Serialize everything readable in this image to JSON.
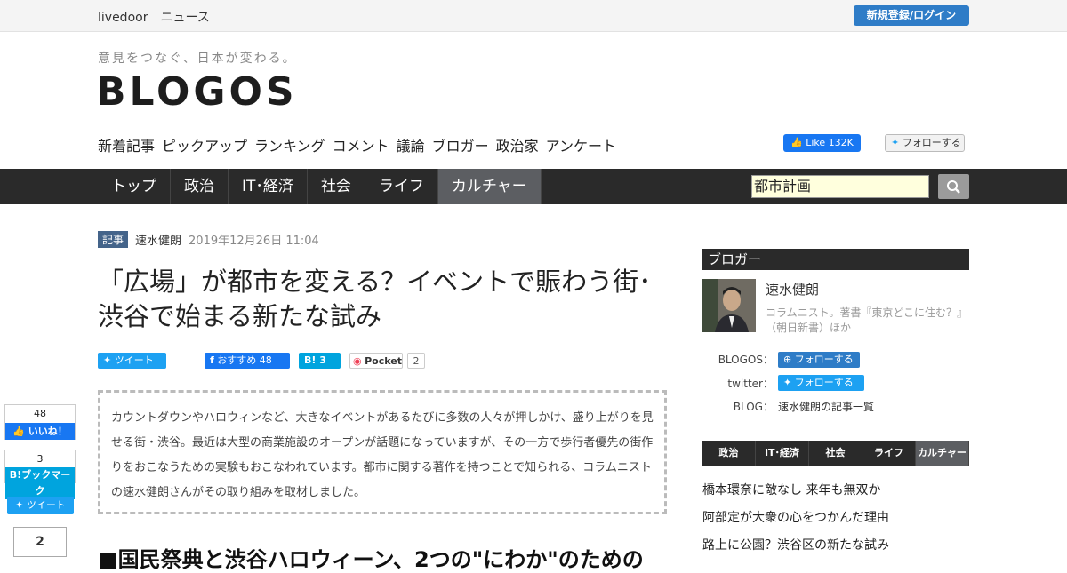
{
  "topbar": {
    "site": "livedoor　ニュース",
    "login": "新規登録/ログイン"
  },
  "brand": {
    "tagline": "意見をつなぐ、日本が変わる。",
    "logo": "BLOGOS"
  },
  "subnav": [
    "新着記事",
    "ピックアップ",
    "ランキング",
    "コメント",
    "議論",
    "ブロガー",
    "政治家",
    "アンケート"
  ],
  "social": {
    "fb_like": "Like 132K",
    "tw_follow": "フォローする"
  },
  "mainnav": [
    "トップ",
    "政治",
    "IT･経済",
    "社会",
    "ライフ",
    "カルチャー"
  ],
  "search": {
    "value": "都市計画"
  },
  "article": {
    "badge": "記事",
    "author": "速水健朗",
    "date": "2019年12月26日 11:04",
    "title": "「広場」が都市を変える？イベントで賑わう街･ 渋谷で始まる新たな試み",
    "lead": "カウントダウンやハロウィンなど、大きなイベントがあるたびに多数の人々が押しかけ、盛り上がりを見せる街・渋谷。最近は大型の商業施設のオープンが話題になっていますが、その一方で歩行者優先の街作りをおこなうための実験もおこなわれています。都市に関する著作を持つことで知られる、コラムニストの速水健朗さんがその取り組みを取材しました。",
    "heading": "■国民祭典と渋谷ハロウィーン、2つの\"にわか\"のための"
  },
  "share": {
    "tweet": "ツイート",
    "fb": "おすすめ 48",
    "hatena": "B! 3",
    "pocket": "Pocket",
    "pocket_count": "2"
  },
  "side": {
    "like_count": "48",
    "like_label": "いいね！",
    "bm_count": "3",
    "bm_label": "B!ブックマーク",
    "tweet": "ツイート",
    "pocket_count": "2"
  },
  "right": {
    "head": "ブロガー",
    "name": "速水健朗",
    "desc": "コラムニスト。著書『東京どこに住む？』（朝日新書）ほか",
    "blogos_label": "BLOGOS：",
    "blogos_btn": "フォローする",
    "twitter_label": "twitter：",
    "twitter_btn": "フォローする",
    "blog_label": "BLOG：",
    "blog_link": "速水健朗の記事一覧",
    "tabs": [
      "政治",
      "IT･経済",
      "社会",
      "ライフ",
      "カルチャー"
    ],
    "links": [
      "橋本環奈に敵なし 来年も無双か",
      "阿部定が大衆の心をつかんだ理由",
      "路上に公園？渋谷区の新たな試み"
    ]
  }
}
